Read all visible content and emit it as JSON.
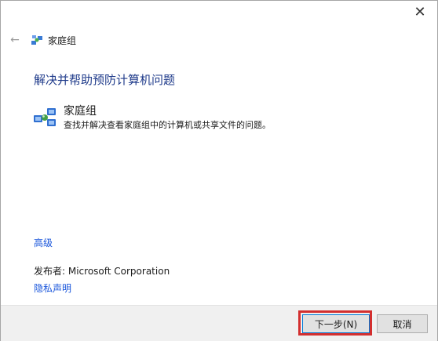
{
  "window": {
    "close_label": "✕"
  },
  "nav": {
    "back_label": "←",
    "breadcrumb": "家庭组"
  },
  "main": {
    "heading": "解决并帮助预防计算机问题",
    "item": {
      "title": "家庭组",
      "description": "查找并解决查看家庭组中的计算机或共享文件的问题。",
      "icon": "homegroup-icon"
    },
    "advanced_link": "高级",
    "publisher": "发布者: Microsoft Corporation",
    "privacy_link": "隐私声明"
  },
  "footer": {
    "next_label": "下一步(N)",
    "cancel_label": "取消"
  },
  "colors": {
    "heading": "#1e3a8a",
    "link": "#1a56db",
    "highlight": "#d32f2f",
    "footer_bg": "#f0f0f0"
  }
}
